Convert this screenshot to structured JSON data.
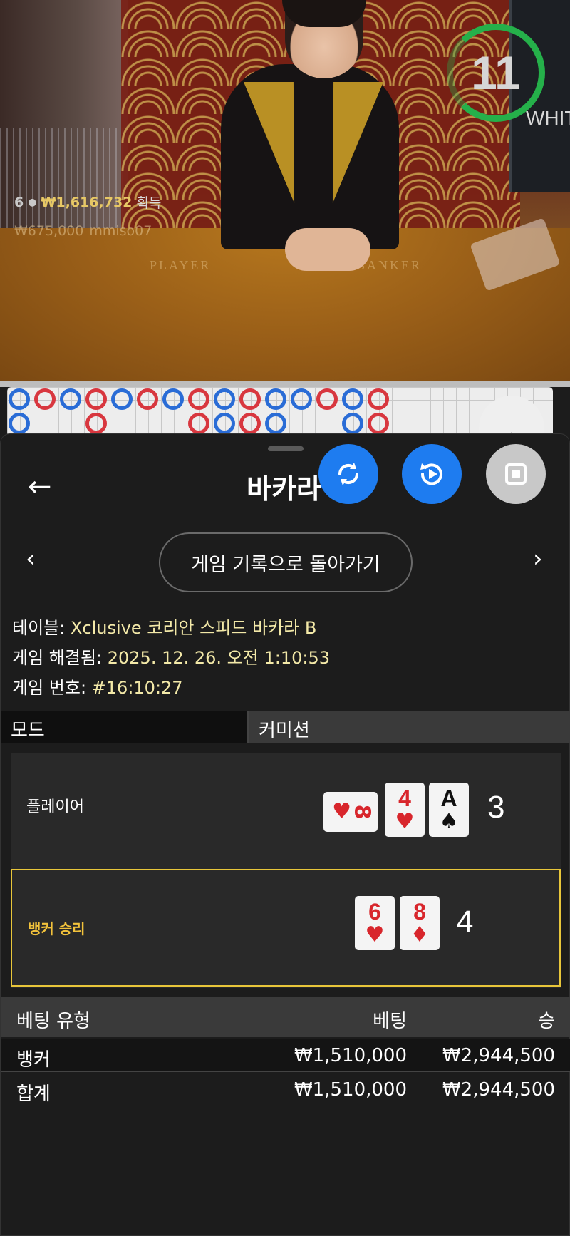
{
  "stream": {
    "timer": "11",
    "monitor_text": "WHITE",
    "table_labels": [
      "PLAYER",
      "BANKER"
    ],
    "winner_count": "6",
    "winner_amount": "₩1,616,732",
    "winner_label": "획득",
    "recent_win_amount": "₩675,000",
    "recent_win_user": "mmiso07"
  },
  "roadmap": {
    "top_row": [
      "b",
      "r",
      "b",
      "r",
      "b",
      "r",
      "b",
      "r",
      "b",
      "r",
      "b",
      "b",
      "r",
      "b",
      "r"
    ],
    "bottom_row": [
      "b",
      "",
      "",
      "r",
      "",
      "",
      "",
      "r",
      "b",
      "r",
      "b",
      "",
      "",
      "b",
      "r"
    ],
    "collapse_icon": "double-chevron-up-icon"
  },
  "sheet": {
    "title": "바카라",
    "back_icon": "←",
    "return_label": "게임 기록으로 돌아가기",
    "prev_icon": "‹",
    "next_icon": "›",
    "btn_icons": [
      "rotate-sync-icon",
      "replay-icon",
      "stop-icon"
    ]
  },
  "info": {
    "table_key": "테이블: ",
    "table_val": "Xclusive 코리안 스피드 바카라 B",
    "resolved_key": "게임 해결됨: ",
    "resolved_val": "2025. 12. 26. 오전 1:10:53",
    "number_key": "게임 번호: ",
    "number_val": "#16:10:27"
  },
  "mode": {
    "mode_label": "모드",
    "commission_label": "커미션"
  },
  "result": {
    "player_label": "플레이어",
    "player_cards": [
      {
        "rank": "8",
        "suit": "♥",
        "color": "red",
        "sideways": true
      },
      {
        "rank": "4",
        "suit": "♥",
        "color": "red"
      },
      {
        "rank": "A",
        "suit": "♠",
        "color": "black"
      }
    ],
    "player_total": "3",
    "banker_label": "뱅커 승리",
    "banker_cards": [
      {
        "rank": "6",
        "suit": "♥",
        "color": "red"
      },
      {
        "rank": "8",
        "suit": "♦",
        "color": "red"
      }
    ],
    "banker_total": "4"
  },
  "bets": {
    "headers": {
      "type": "베팅 유형",
      "bet": "베팅",
      "win": "승"
    },
    "rows": [
      {
        "type": "뱅커",
        "bet": "₩1,510,000",
        "win": "₩2,944,500"
      },
      {
        "type": "합계",
        "bet": "₩1,510,000",
        "win": "₩2,944,500"
      }
    ]
  },
  "colors": {
    "accent_blue": "#1e7cf0",
    "banker_gold": "#e8c63a",
    "value_cream": "#f3e9a8",
    "timer_green": "#25b04a"
  }
}
